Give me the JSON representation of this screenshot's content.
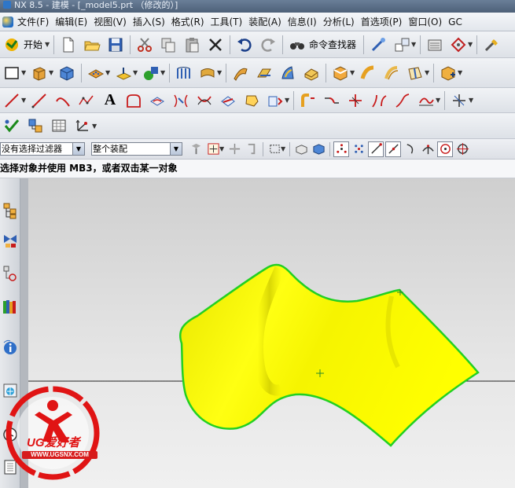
{
  "window": {
    "title": "NX 8.5 - 建模 - [_model5.prt （修改的）]"
  },
  "menu": {
    "items": [
      "文件(F)",
      "编辑(E)",
      "视图(V)",
      "插入(S)",
      "格式(R)",
      "工具(T)",
      "装配(A)",
      "信息(I)",
      "分析(L)",
      "首选项(P)",
      "窗口(O)",
      "GC"
    ]
  },
  "toolbar": {
    "start_label": "开始",
    "command_finder_label": "命令查找器",
    "text_tool_glyph": "A"
  },
  "selection": {
    "filter_value": "没有选择过滤器",
    "scope_value": "整个装配"
  },
  "cue_line": {
    "text": "选择对象并使用 MB3，或者双击某一对象"
  },
  "colors": {
    "body_fill": "#ffff00",
    "body_edge": "#22d022",
    "viewport_top": "#cfcfcf",
    "viewport_bottom": "#f0f0f0",
    "watermark": "#e01414"
  },
  "watermark": {
    "brand": "UG爱好者",
    "url": "WWW.UGSNX.COM"
  }
}
